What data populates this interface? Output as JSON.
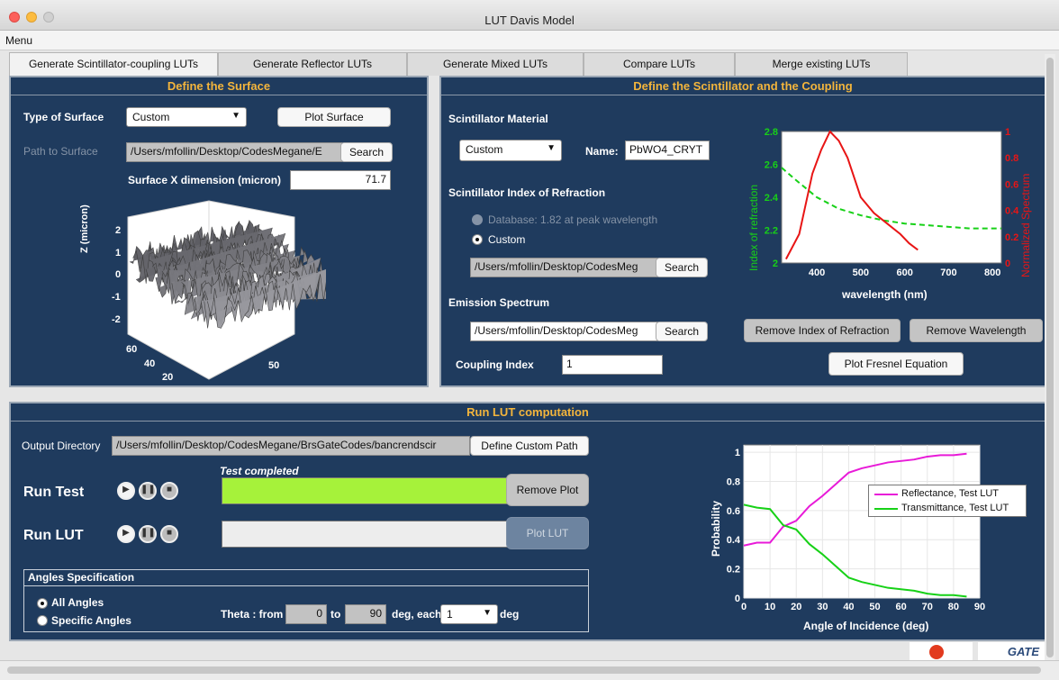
{
  "window": {
    "title": "LUT Davis Model"
  },
  "menu": {
    "label": "Menu"
  },
  "tabs": [
    {
      "label": "Generate Scintillator-coupling LUTs",
      "active": true
    },
    {
      "label": "Generate Reflector LUTs",
      "active": false
    },
    {
      "label": "Generate Mixed LUTs",
      "active": false
    },
    {
      "label": "Compare LUTs",
      "active": false
    },
    {
      "label": "Merge existing LUTs",
      "active": false
    }
  ],
  "surface": {
    "title": "Define the Surface",
    "type_label": "Type of Surface",
    "type_value": "Custom",
    "plot_button": "Plot Surface",
    "path_label": "Path to Surface",
    "path_value": "/Users/mfollin/Desktop/CodesMegane/E",
    "search_button": "Search",
    "xdim_label": "Surface X dimension (micron)",
    "xdim_value": "71.7",
    "plot": {
      "zlabel": "Z (micron)",
      "zticks": [
        "2",
        "1",
        "0",
        "-1",
        "-2"
      ],
      "yticks": [
        "60",
        "40",
        "20"
      ],
      "xticks": [
        "50"
      ]
    }
  },
  "scint": {
    "title": "Define the Scintillator and the Coupling",
    "material_label": "Scintillator Material",
    "material_value": "Custom",
    "name_label": "Name:",
    "name_value": "PbWO4_CRYT",
    "ior_label": "Scintillator Index of Refraction",
    "database_option": "Database: 1.82 at peak wavelength",
    "custom_option": "Custom",
    "ior_path": "/Users/mfollin/Desktop/CodesMeg",
    "search_button": "Search",
    "emission_label": "Emission Spectrum",
    "emission_path": "/Users/mfollin/Desktop/CodesMeg",
    "coupling_label": "Coupling Index",
    "coupling_value": "1",
    "remove_ior_button": "Remove Index of Refraction",
    "remove_wl_button": "Remove Wavelength",
    "fresnel_button": "Plot Fresnel Equation"
  },
  "run": {
    "title": "Run LUT computation",
    "output_label": "Output Directory",
    "output_value": "/Users/mfollin/Desktop/CodesMegane/BrsGateCodes/bancrendscir",
    "define_path_button": "Define Custom Path",
    "test_status": "Test completed",
    "run_test_label": "Run Test",
    "run_lut_label": "Run LUT",
    "test_progress": 1.0,
    "lut_progress": 0.0,
    "remove_plot_button": "Remove Plot",
    "plot_lut_button": "Plot LUT",
    "angles_title": "Angles Specification",
    "all_angles": "All Angles",
    "specific_angles": "Specific Angles",
    "theta_label": "Theta : from",
    "theta_from": "0",
    "to_label": "to",
    "theta_to": "90",
    "each_label": "deg, each",
    "step_value": "1",
    "deg_label": "deg"
  },
  "logos": {
    "gate": "GATE"
  },
  "colors": {
    "panel": "#1f3b5e",
    "title": "#f3b53c",
    "progress": "#a6f23a",
    "green": "#17d117",
    "red": "#e81515",
    "magenta": "#e81ad8"
  },
  "chart_data": [
    {
      "type": "line",
      "xlabel": "wavelength (nm)",
      "ylabel": "Index of refraction",
      "y2label": "Normalized Spectrum",
      "xlim": [
        320,
        820
      ],
      "ylim": [
        2.0,
        2.8
      ],
      "y2lim": [
        0,
        1
      ],
      "xticks": [
        400,
        500,
        600,
        700,
        800
      ],
      "yticks": [
        2,
        2.2,
        2.4,
        2.6,
        2.8
      ],
      "y2ticks": [
        0,
        0.2,
        0.4,
        0.6,
        0.8,
        1
      ],
      "series": [
        {
          "axis": "left",
          "color": "#17d117",
          "dashed": true,
          "x": [
            320,
            350,
            400,
            450,
            500,
            550,
            600,
            650,
            700,
            750,
            800,
            820
          ],
          "y": [
            2.58,
            2.51,
            2.4,
            2.33,
            2.29,
            2.26,
            2.24,
            2.23,
            2.22,
            2.21,
            2.21,
            2.21
          ]
        },
        {
          "axis": "right",
          "color": "#e81515",
          "dashed": false,
          "x": [
            330,
            360,
            390,
            410,
            430,
            450,
            470,
            500,
            530,
            560,
            590,
            610,
            630
          ],
          "y": [
            0.03,
            0.22,
            0.68,
            0.86,
            1.0,
            0.93,
            0.8,
            0.5,
            0.38,
            0.3,
            0.22,
            0.15,
            0.1
          ]
        }
      ]
    },
    {
      "type": "line",
      "xlabel": "Angle of Incidence (deg)",
      "ylabel": "Probability",
      "xlim": [
        0,
        90
      ],
      "ylim": [
        0,
        1.05
      ],
      "xticks": [
        0,
        10,
        20,
        30,
        40,
        50,
        60,
        70,
        80,
        90
      ],
      "yticks": [
        0,
        0.2,
        0.4,
        0.6,
        0.8,
        1
      ],
      "series": [
        {
          "name": "Reflectance, Test LUT",
          "color": "#e81ad8",
          "x": [
            0,
            5,
            10,
            15,
            20,
            25,
            30,
            35,
            40,
            45,
            50,
            55,
            60,
            65,
            70,
            75,
            80,
            85
          ],
          "y": [
            0.36,
            0.38,
            0.38,
            0.49,
            0.53,
            0.63,
            0.7,
            0.78,
            0.86,
            0.89,
            0.91,
            0.93,
            0.94,
            0.95,
            0.97,
            0.98,
            0.98,
            0.99
          ]
        },
        {
          "name": "Transmittance, Test LUT",
          "color": "#17d117",
          "x": [
            0,
            5,
            10,
            15,
            20,
            25,
            30,
            35,
            40,
            45,
            50,
            55,
            60,
            65,
            70,
            75,
            80,
            85
          ],
          "y": [
            0.64,
            0.62,
            0.61,
            0.5,
            0.47,
            0.37,
            0.3,
            0.22,
            0.14,
            0.11,
            0.09,
            0.07,
            0.06,
            0.05,
            0.03,
            0.02,
            0.02,
            0.01
          ]
        }
      ]
    }
  ]
}
